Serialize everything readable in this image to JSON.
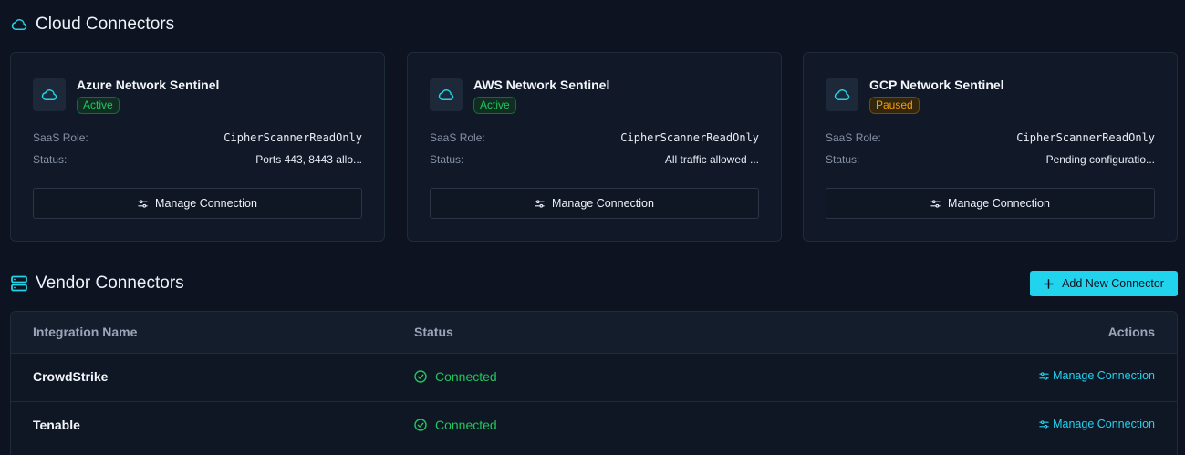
{
  "cloud": {
    "title": "Cloud Connectors",
    "labels": {
      "role": "SaaS Role:",
      "status": "Status:"
    },
    "cards": [
      {
        "name": "Azure Network Sentinel",
        "badge": "Active",
        "role": "CipherScannerReadOnly",
        "status": "Ports 443, 8443 allo...",
        "button": "Manage Connection"
      },
      {
        "name": "AWS Network Sentinel",
        "badge": "Active",
        "role": "CipherScannerReadOnly",
        "status": "All traffic allowed ...",
        "button": "Manage Connection"
      },
      {
        "name": "GCP Network Sentinel",
        "badge": "Paused",
        "role": "CipherScannerReadOnly",
        "status": "Pending configuratio...",
        "button": "Manage Connection"
      }
    ]
  },
  "vendor": {
    "title": "Vendor Connectors",
    "add_button": "Add New Connector",
    "columns": {
      "name": "Integration Name",
      "status": "Status",
      "actions": "Actions"
    },
    "rows": [
      {
        "name": "CrowdStrike",
        "status": "Connected",
        "action": "Manage Connection"
      },
      {
        "name": "Tenable",
        "status": "Connected",
        "action": "Manage Connection"
      }
    ]
  },
  "colors": {
    "accent": "#22d3ee",
    "success": "#22c55e",
    "warning": "#f59e0b",
    "background": "#0d1320"
  },
  "icons": {
    "section_cloud": "cloud-icon",
    "section_vendor": "server-icon",
    "card": "cloud-icon",
    "manage": "sliders-icon",
    "add": "plus-icon",
    "status": "check-circle-icon"
  }
}
